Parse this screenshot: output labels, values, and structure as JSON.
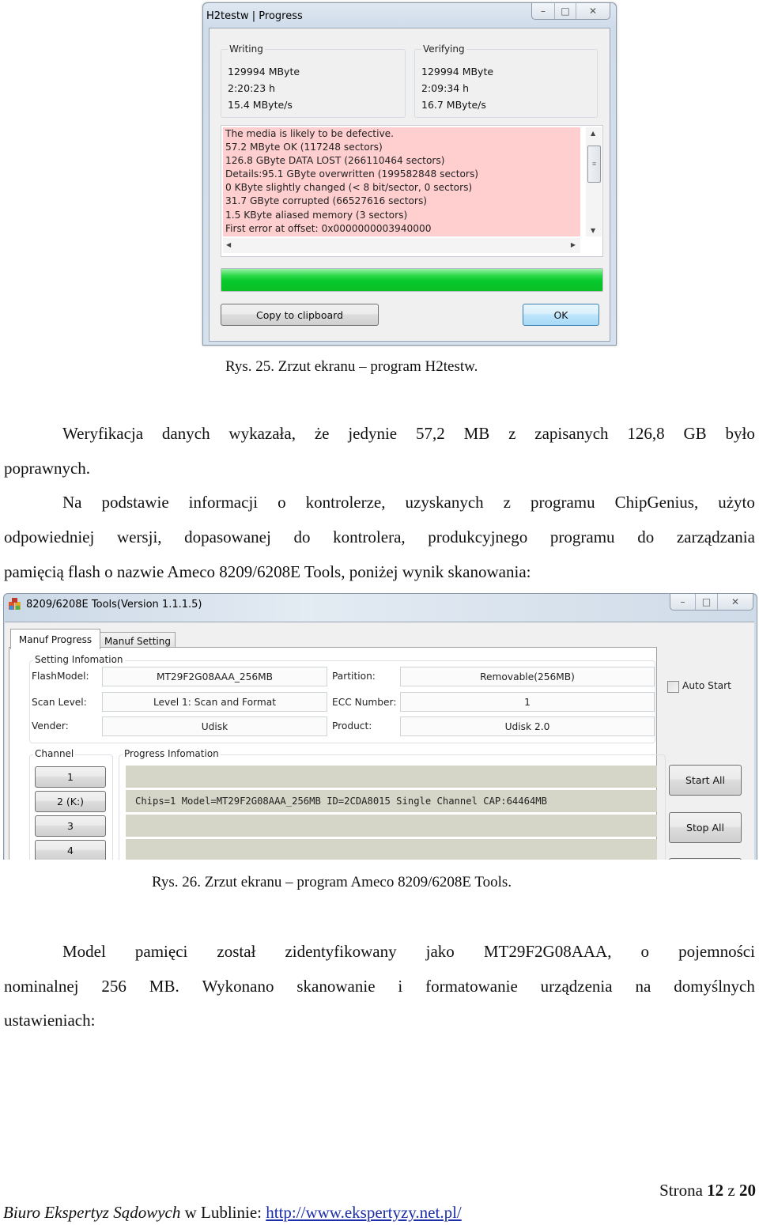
{
  "figure25": {
    "window": {
      "title": "H2testw | Progress",
      "controls": {
        "minimize": "–",
        "maximize": "□",
        "close": "✕"
      },
      "writing": {
        "label": "Writing",
        "size": "129994 MByte",
        "time": "2:20:23 h",
        "speed": "15.4 MByte/s"
      },
      "verifying": {
        "label": "Verifying",
        "size": "129994 MByte",
        "time": "2:09:34 h",
        "speed": "16.7 MByte/s"
      },
      "result_lines": [
        "The media is likely to be defective.",
        "57.2 MByte OK (117248 sectors)",
        "126.8 GByte DATA LOST (266110464 sectors)",
        "Details:95.1 GByte overwritten (199582848 sectors)",
        "0 KByte slightly changed (< 8 bit/sector, 0 sectors)",
        "31.7 GByte corrupted (66527616 sectors)",
        "1.5 KByte aliased memory (3 sectors)",
        "First error at offset: 0x0000000003940000"
      ],
      "result_bg_color": "#ffcfd0",
      "scroll_icons": {
        "up": "▲",
        "down": "▼",
        "left": "◀",
        "right": "▶",
        "grip": "≡"
      },
      "progress_percent": 100,
      "progress_color": "#06c92a",
      "buttons": {
        "copy": "Copy to clipboard",
        "ok": "OK"
      }
    },
    "caption": "Rys. 25. Zrzut ekranu – program H2testw."
  },
  "paragraphs": {
    "p1": {
      "line1_words": [
        "Weryfikacja",
        "danych",
        "wykazała,",
        "że",
        "jedynie",
        "57,2",
        "MB",
        "z",
        "zapisanych",
        "126,8",
        "GB",
        "było"
      ],
      "line2": "poprawnych."
    },
    "p2": {
      "line1_words": [
        "Na",
        "podstawie",
        "informacji",
        "o",
        "kontrolerze,",
        "uzyskanych",
        "z",
        "programu",
        "ChipGenius,",
        "użyto"
      ],
      "line2_words": [
        "odpowiedniej",
        "wersji,",
        "dopasowanej",
        "do",
        "kontrolera,",
        "produkcyjnego",
        "programu",
        "do",
        "zarządzania"
      ],
      "line3": "pamięcią flash o nazwie Ameco 8209/6208E Tools, poniżej wynik skanowania:"
    }
  },
  "figure26": {
    "window": {
      "title": "8209/6208E Tools(Version 1.1.1.5)",
      "controls": {
        "minimize": "–",
        "maximize": "□",
        "close": "✕"
      },
      "tabs": [
        {
          "label": "Manuf Progress",
          "active": true
        },
        {
          "label": "Manuf Setting",
          "active": false
        }
      ],
      "setting_info": {
        "legend": "Setting Infomation",
        "flash_model_label": "FlashModel:",
        "flash_model_value": "MT29F2G08AAA_256MB",
        "scan_level_label": "Scan Level:",
        "scan_level_value": "Level 1: Scan and Format",
        "vender_label": "Vender:",
        "vender_value": "Udisk",
        "partition_label": "Partition:",
        "partition_value": "Removable(256MB)",
        "ecc_label": "ECC Number:",
        "ecc_value": "1",
        "product_label": "Product:",
        "product_value": "Udisk 2.0"
      },
      "auto_start": {
        "label": "Auto Start",
        "checked": false
      },
      "channel": {
        "legend": "Channel",
        "buttons": [
          "1",
          "2 (K:)",
          "3",
          "4"
        ]
      },
      "progress_info": {
        "legend": "Progress Infomation",
        "rows": [
          "",
          "Chips=1 Model=MT29F2G08AAA_256MB ID=2CDA8015 Single Channel CAP:64464MB",
          "",
          ""
        ]
      },
      "actions": {
        "start_all": "Start All",
        "stop_all": "Stop All"
      }
    },
    "caption": "Rys. 26. Zrzut ekranu – program Ameco 8209/6208E Tools."
  },
  "paragraph3": {
    "line1_words": [
      "Model",
      "pamięci",
      "został",
      "zidentyfikowany",
      "jako",
      "MT29F2G08AAA,",
      "o",
      "pojemności"
    ],
    "line2_words": [
      "nominalnej",
      "256",
      "MB.",
      "Wykonano",
      "skanowanie",
      "i",
      "formatowanie",
      "urządzenia",
      "na",
      "domyślnych"
    ],
    "line3": "ustawieniach:"
  },
  "footer": {
    "page_prefix": "Strona",
    "page_current": "12",
    "page_sep": "z",
    "page_total": "20",
    "office_italic": "Biuro Ekspertyz Sądowych",
    "office_rest": " w Lublinie: ",
    "link_text": "http://www.ekspertyzy.net.pl/",
    "link_color": "#1c2fa8"
  }
}
